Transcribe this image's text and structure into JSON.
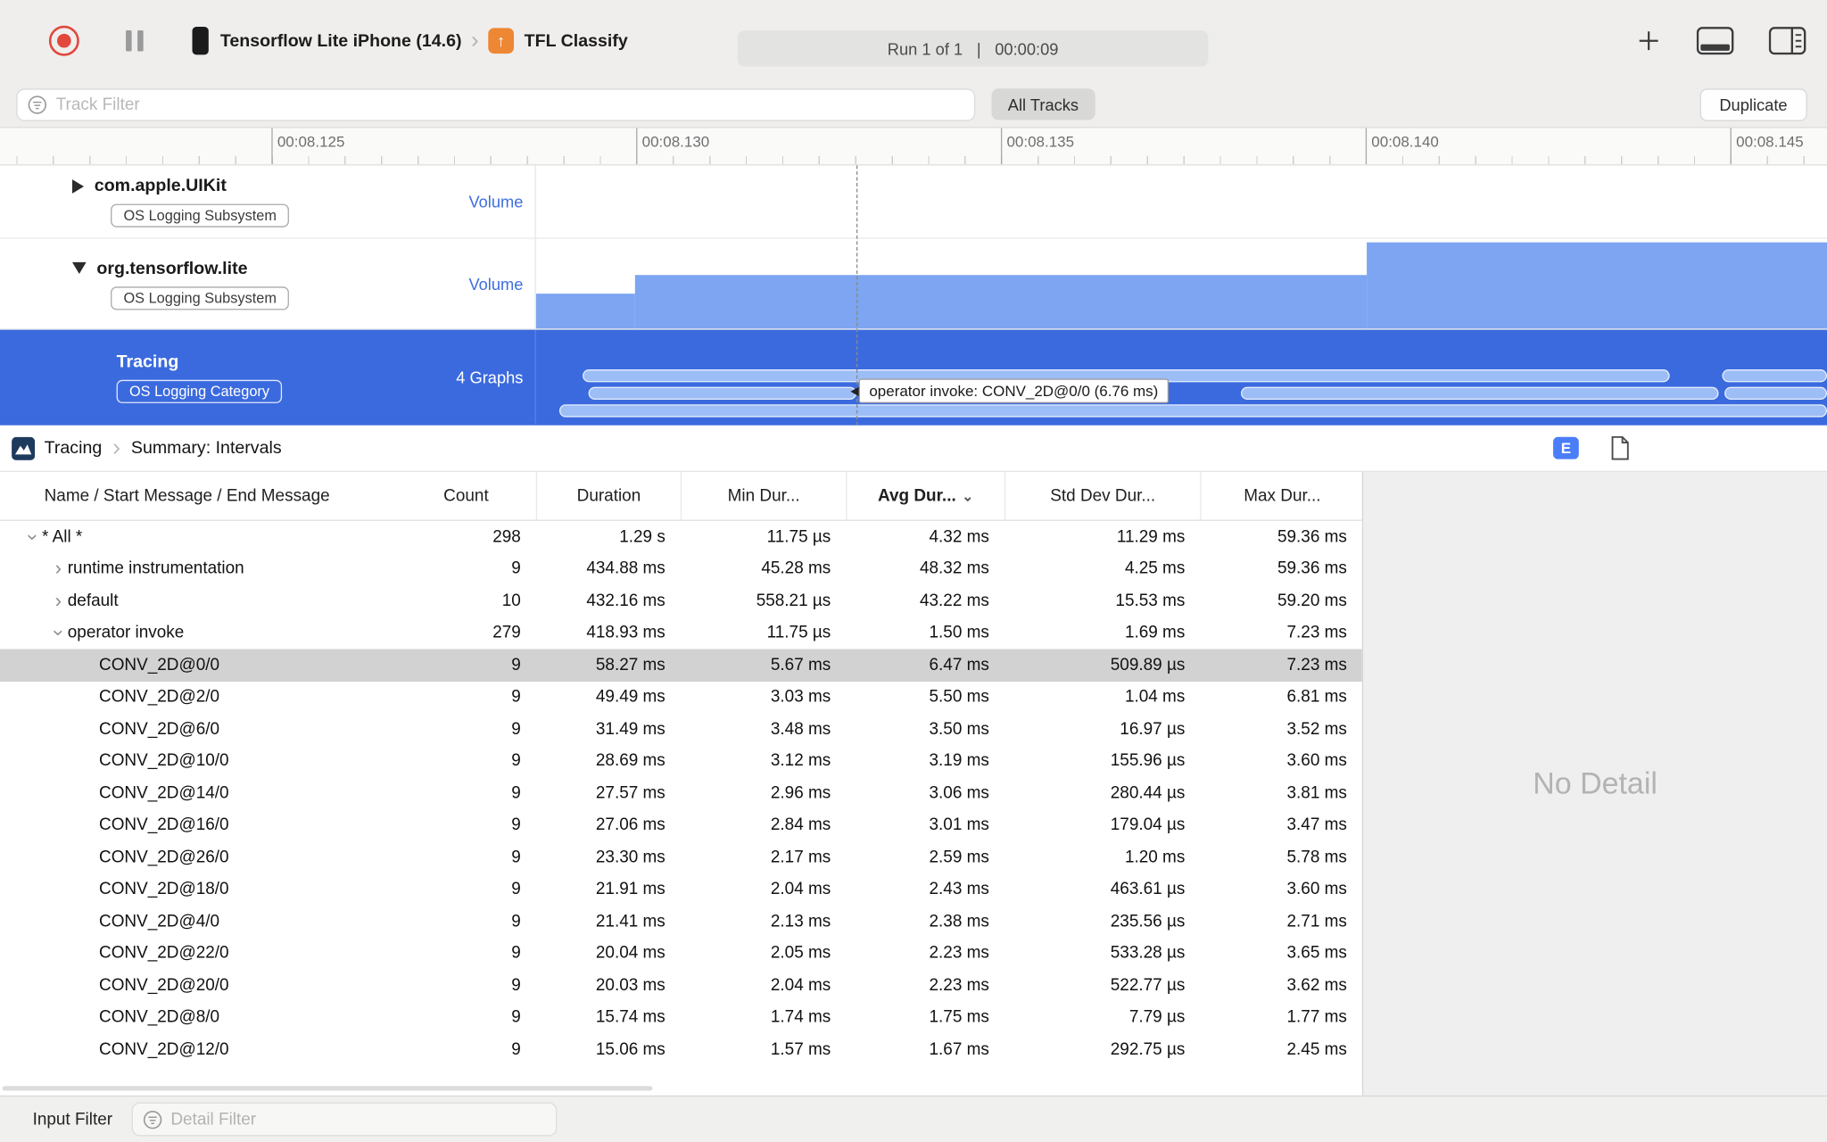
{
  "toolbar": {
    "device_name": "Tensorflow Lite iPhone (14.6)",
    "target_name": "TFL Classify",
    "run_status": {
      "run": "Run 1 of 1",
      "divider": "|",
      "time": "00:00:09"
    }
  },
  "filter_bar": {
    "track_filter_placeholder": "Track Filter",
    "all_tracks_button": "All Tracks",
    "duplicate_button": "Duplicate"
  },
  "timeline": {
    "ruler_ticks": [
      "00:08.125",
      "00:08.130",
      "00:08.135",
      "00:08.140",
      "00:08.145"
    ],
    "tracks": [
      {
        "name": "com.apple.UIKit",
        "badge": "OS Logging Subsystem",
        "detail": "Volume",
        "disclosure": "collapsed",
        "selected": false
      },
      {
        "name": "org.tensorflow.lite",
        "badge": "OS Logging Subsystem",
        "detail": "Volume",
        "disclosure": "expanded",
        "selected": false
      },
      {
        "name": "Tracing",
        "badge": "OS Logging Category",
        "detail": "4 Graphs",
        "disclosure": "none",
        "selected": true
      }
    ],
    "tooltip": "operator invoke: CONV_2D@0/0 (6.76 ms)"
  },
  "summary_pane": {
    "breadcrumb": {
      "root": "Tracing",
      "current": "Summary: Intervals"
    },
    "extended_detail_label": "E",
    "columns": [
      "Name / Start Message / End Message",
      "Count",
      "Duration",
      "Min Dur...",
      "Avg Dur...",
      "Std Dev Dur...",
      "Max Dur..."
    ],
    "sorted_column": "Avg Dur...",
    "rows": [
      {
        "level": 0,
        "disclosure": "expanded",
        "selected": false,
        "name": "* All *",
        "count": "298",
        "duration": "1.29 s",
        "min": "11.75 µs",
        "avg": "4.32 ms",
        "std_dev": "11.29 ms",
        "max": "59.36 ms"
      },
      {
        "level": 1,
        "disclosure": "collapsed",
        "selected": false,
        "name": "runtime instrumentation",
        "count": "9",
        "duration": "434.88 ms",
        "min": "45.28 ms",
        "avg": "48.32 ms",
        "std_dev": "4.25 ms",
        "max": "59.36 ms"
      },
      {
        "level": 1,
        "disclosure": "collapsed",
        "selected": false,
        "name": "default",
        "count": "10",
        "duration": "432.16 ms",
        "min": "558.21 µs",
        "avg": "43.22 ms",
        "std_dev": "15.53 ms",
        "max": "59.20 ms"
      },
      {
        "level": 1,
        "disclosure": "expanded",
        "selected": false,
        "name": "operator invoke",
        "count": "279",
        "duration": "418.93 ms",
        "min": "11.75 µs",
        "avg": "1.50 ms",
        "std_dev": "1.69 ms",
        "max": "7.23 ms"
      },
      {
        "level": 2,
        "disclosure": "none",
        "selected": true,
        "name": "CONV_2D@0/0",
        "count": "9",
        "duration": "58.27 ms",
        "min": "5.67 ms",
        "avg": "6.47 ms",
        "std_dev": "509.89 µs",
        "max": "7.23 ms"
      },
      {
        "level": 2,
        "disclosure": "none",
        "selected": false,
        "name": "CONV_2D@2/0",
        "count": "9",
        "duration": "49.49 ms",
        "min": "3.03 ms",
        "avg": "5.50 ms",
        "std_dev": "1.04 ms",
        "max": "6.81 ms"
      },
      {
        "level": 2,
        "disclosure": "none",
        "selected": false,
        "name": "CONV_2D@6/0",
        "count": "9",
        "duration": "31.49 ms",
        "min": "3.48 ms",
        "avg": "3.50 ms",
        "std_dev": "16.97 µs",
        "max": "3.52 ms"
      },
      {
        "level": 2,
        "disclosure": "none",
        "selected": false,
        "name": "CONV_2D@10/0",
        "count": "9",
        "duration": "28.69 ms",
        "min": "3.12 ms",
        "avg": "3.19 ms",
        "std_dev": "155.96 µs",
        "max": "3.60 ms"
      },
      {
        "level": 2,
        "disclosure": "none",
        "selected": false,
        "name": "CONV_2D@14/0",
        "count": "9",
        "duration": "27.57 ms",
        "min": "2.96 ms",
        "avg": "3.06 ms",
        "std_dev": "280.44 µs",
        "max": "3.81 ms"
      },
      {
        "level": 2,
        "disclosure": "none",
        "selected": false,
        "name": "CONV_2D@16/0",
        "count": "9",
        "duration": "27.06 ms",
        "min": "2.84 ms",
        "avg": "3.01 ms",
        "std_dev": "179.04 µs",
        "max": "3.47 ms"
      },
      {
        "level": 2,
        "disclosure": "none",
        "selected": false,
        "name": "CONV_2D@26/0",
        "count": "9",
        "duration": "23.30 ms",
        "min": "2.17 ms",
        "avg": "2.59 ms",
        "std_dev": "1.20 ms",
        "max": "5.78 ms"
      },
      {
        "level": 2,
        "disclosure": "none",
        "selected": false,
        "name": "CONV_2D@18/0",
        "count": "9",
        "duration": "21.91 ms",
        "min": "2.04 ms",
        "avg": "2.43 ms",
        "std_dev": "463.61 µs",
        "max": "3.60 ms"
      },
      {
        "level": 2,
        "disclosure": "none",
        "selected": false,
        "name": "CONV_2D@4/0",
        "count": "9",
        "duration": "21.41 ms",
        "min": "2.13 ms",
        "avg": "2.38 ms",
        "std_dev": "235.56 µs",
        "max": "2.71 ms"
      },
      {
        "level": 2,
        "disclosure": "none",
        "selected": false,
        "name": "CONV_2D@22/0",
        "count": "9",
        "duration": "20.04 ms",
        "min": "2.05 ms",
        "avg": "2.23 ms",
        "std_dev": "533.28 µs",
        "max": "3.65 ms"
      },
      {
        "level": 2,
        "disclosure": "none",
        "selected": false,
        "name": "CONV_2D@20/0",
        "count": "9",
        "duration": "20.03 ms",
        "min": "2.04 ms",
        "avg": "2.23 ms",
        "std_dev": "522.77 µs",
        "max": "3.62 ms"
      },
      {
        "level": 2,
        "disclosure": "none",
        "selected": false,
        "name": "CONV_2D@8/0",
        "count": "9",
        "duration": "15.74 ms",
        "min": "1.74 ms",
        "avg": "1.75 ms",
        "std_dev": "7.79 µs",
        "max": "1.77 ms"
      },
      {
        "level": 2,
        "disclosure": "none",
        "selected": false,
        "name": "CONV_2D@12/0",
        "count": "9",
        "duration": "15.06 ms",
        "min": "1.57 ms",
        "avg": "1.67 ms",
        "std_dev": "292.75 µs",
        "max": "2.45 ms"
      }
    ]
  },
  "detail_pane": {
    "placeholder": "No Detail"
  },
  "status_bar": {
    "input_filter_label": "Input Filter",
    "detail_filter_placeholder": "Detail Filter"
  }
}
